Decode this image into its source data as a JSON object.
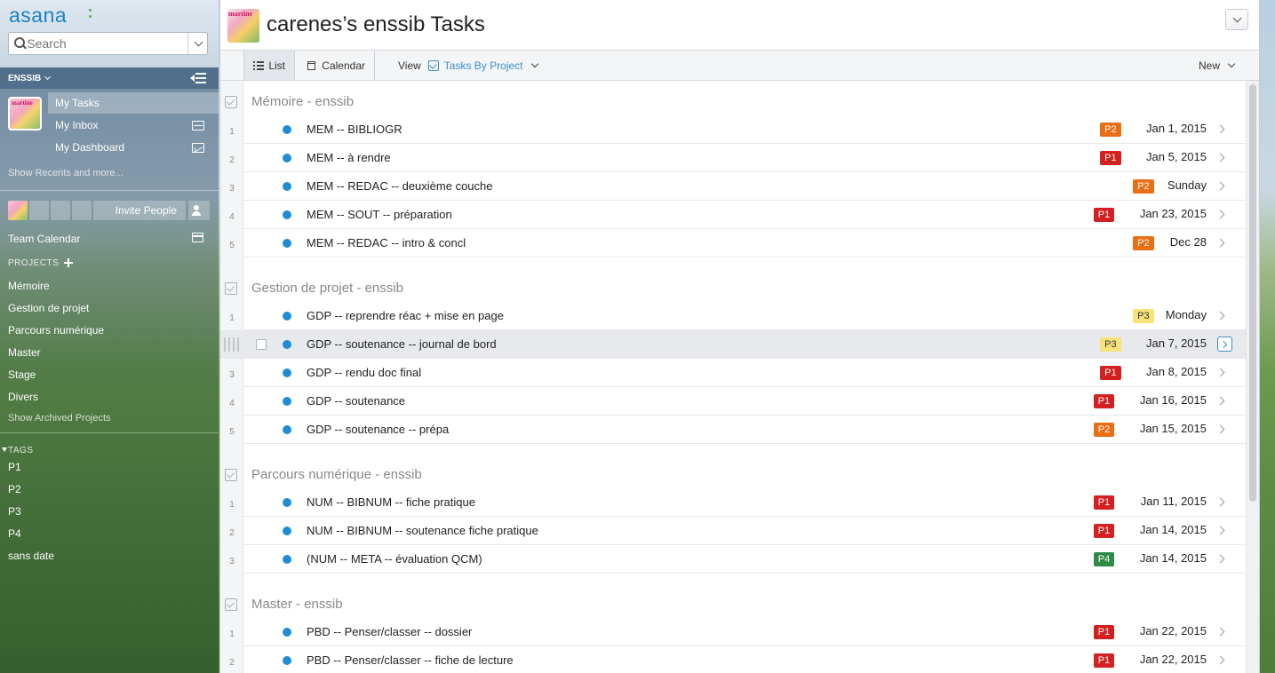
{
  "app": {
    "logo": "asana"
  },
  "search": {
    "placeholder": "Search"
  },
  "workspace": {
    "name": "ENSSIB"
  },
  "nav": {
    "my_tasks": "My Tasks",
    "my_inbox": "My Inbox",
    "my_dashboard": "My Dashboard",
    "show_recents": "Show Recents and more..."
  },
  "team": {
    "invite": "Invite People",
    "calendar": "Team Calendar"
  },
  "projects": {
    "heading": "PROJECTS",
    "items": [
      "Mémoire",
      "Gestion de projet",
      "Parcours numérique",
      "Master",
      "Stage",
      "Divers"
    ],
    "show_archived": "Show Archived Projects"
  },
  "tags": {
    "heading": "TAGS",
    "items": [
      "P1",
      "P2",
      "P3",
      "P4",
      "sans date"
    ]
  },
  "header": {
    "title": "carenes’s enssib Tasks"
  },
  "toolbar": {
    "list_label": "List",
    "calendar_label": "Calendar",
    "view_label": "View",
    "view_value": "Tasks By Project",
    "new_label": "New"
  },
  "colors": {
    "P1": "#d42020",
    "P2": "#ea6e16",
    "P3": "#f8e27a",
    "P4": "#2e8b47",
    "accent": "#1f8dd6"
  },
  "sections": [
    {
      "title": "Mémoire - enssib",
      "tasks": [
        {
          "num": "1",
          "name": "MEM -- BIBLIOGR",
          "tag": "P2",
          "due": "Jan 1, 2015"
        },
        {
          "num": "2",
          "name": "MEM -- à rendre",
          "tag": "P1",
          "due": "Jan 5, 2015"
        },
        {
          "num": "3",
          "name": "MEM -- REDAC -- deuxième couche",
          "tag": "P2",
          "due": "Sunday"
        },
        {
          "num": "4",
          "name": "MEM -- SOUT -- préparation",
          "tag": "P1",
          "due": "Jan 23, 2015"
        },
        {
          "num": "5",
          "name": "MEM -- REDAC -- intro & concl",
          "tag": "P2",
          "due": "Dec 28"
        }
      ]
    },
    {
      "title": "Gestion de projet - enssib",
      "tasks": [
        {
          "num": "1",
          "name": "GDP -- reprendre réac + mise en page",
          "tag": "P3",
          "due": "Monday"
        },
        {
          "num": "",
          "name": "GDP -- soutenance -- journal de bord",
          "tag": "P3",
          "due": "Jan 7, 2015",
          "highlight": true
        },
        {
          "num": "3",
          "name": "GDP -- rendu doc final",
          "tag": "P1",
          "due": "Jan 8, 2015"
        },
        {
          "num": "4",
          "name": "GDP -- soutenance",
          "tag": "P1",
          "due": "Jan 16, 2015"
        },
        {
          "num": "5",
          "name": "GDP -- soutenance -- prépa",
          "tag": "P2",
          "due": "Jan 15, 2015"
        }
      ]
    },
    {
      "title": "Parcours numérique - enssib",
      "tasks": [
        {
          "num": "1",
          "name": "NUM -- BIBNUM -- fiche pratique",
          "tag": "P1",
          "due": "Jan 11, 2015"
        },
        {
          "num": "2",
          "name": "NUM -- BIBNUM -- soutenance fiche pratique",
          "tag": "P1",
          "due": "Jan 14, 2015"
        },
        {
          "num": "3",
          "name": "(NUM -- META -- évaluation QCM)",
          "tag": "P4",
          "due": "Jan 14, 2015"
        }
      ]
    },
    {
      "title": "Master - enssib",
      "tasks": [
        {
          "num": "1",
          "name": "PBD -- Penser/classer -- dossier",
          "tag": "P1",
          "due": "Jan 22, 2015"
        },
        {
          "num": "2",
          "name": "PBD -- Penser/classer -- fiche de lecture",
          "tag": "P1",
          "due": "Jan 22, 2015"
        }
      ]
    }
  ]
}
